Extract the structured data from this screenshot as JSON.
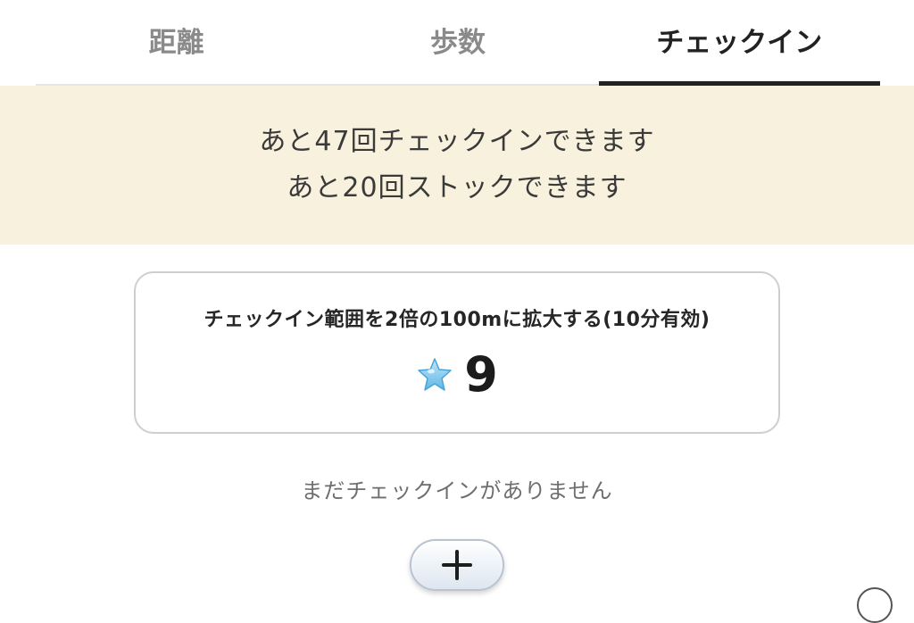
{
  "tabs": [
    {
      "label": "距離",
      "active": false
    },
    {
      "label": "歩数",
      "active": false
    },
    {
      "label": "チェックイン",
      "active": true
    }
  ],
  "banner": {
    "line1": "あと47回チェックインできます",
    "line2": "あと20回ストックできます"
  },
  "boost": {
    "title": "チェックイン範囲を2倍の100mに拡大する(10分有効)",
    "cost_icon": "star-icon",
    "cost": "9"
  },
  "empty_message": "まだチェックインがありません",
  "add_button": {
    "icon": "plus-icon"
  },
  "colors": {
    "banner_bg": "#f8f1dd",
    "active_tab": "#222222",
    "inactive_tab": "#8a8a8a",
    "star": "#8fd0f2"
  }
}
